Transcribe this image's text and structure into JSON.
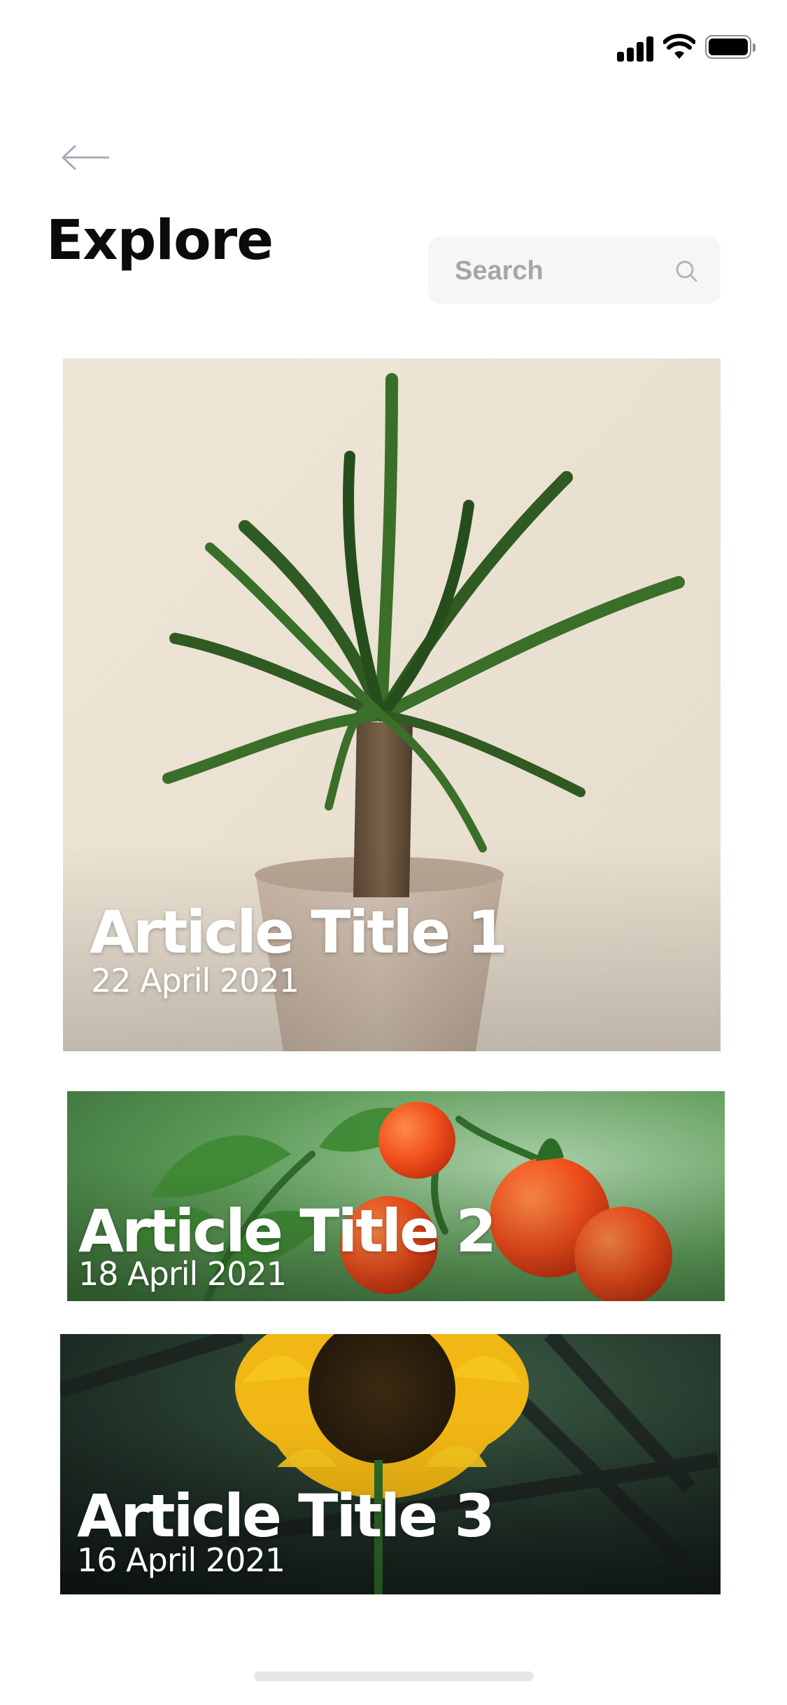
{
  "header": {
    "title": "Explore"
  },
  "search": {
    "placeholder": "Search"
  },
  "articles": [
    {
      "title": "Article Title 1",
      "date": "22 April 2021",
      "image": "potted-palm-plant-image"
    },
    {
      "title": "Article Title 2",
      "date": "18 April 2021",
      "image": "tomato-plant-image"
    },
    {
      "title": "Article Title 3",
      "date": "16 April 2021",
      "image": "sunflower-image"
    }
  ],
  "icons": {
    "back": "arrow-left-icon",
    "search": "magnifier-icon",
    "signal": "cellular-signal-icon",
    "wifi": "wifi-icon",
    "battery": "battery-icon"
  },
  "colors": {
    "background": "#ffffff",
    "title": "#0b0b0b",
    "search_bg": "#f6f6f7",
    "placeholder": "#a6a6a8",
    "card_text": "#ffffff"
  }
}
